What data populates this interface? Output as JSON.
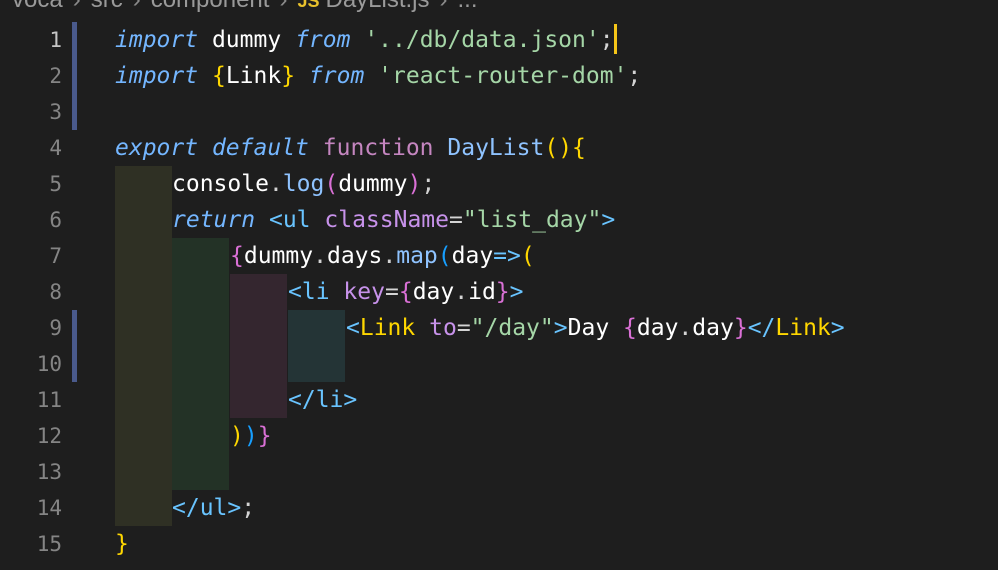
{
  "breadcrumb": [
    "voca",
    "src",
    "component",
    "DayList.js",
    "..."
  ],
  "breadcrumb_icon": "JS",
  "line_numbers": [
    "1",
    "2",
    "3",
    "4",
    "5",
    "6",
    "7",
    "8",
    "9",
    "10",
    "11",
    "12",
    "13",
    "14",
    "15"
  ],
  "code": {
    "l1": [
      "import",
      " ",
      "dummy",
      " ",
      "from",
      " ",
      "'../db/data.json'",
      ";"
    ],
    "l2": [
      "import",
      " ",
      "{",
      "Link",
      "}",
      " ",
      "from",
      " ",
      "'react-router-dom'",
      ";"
    ],
    "l4": [
      "export",
      " ",
      "default",
      " ",
      "function",
      " ",
      "DayList",
      "(",
      ")",
      "{"
    ],
    "l5": [
      "console",
      ".",
      "log",
      "(",
      "dummy",
      ")",
      ";"
    ],
    "l6": [
      "return",
      " ",
      "<",
      "ul",
      " ",
      "className",
      "=",
      "\"list_day\"",
      ">"
    ],
    "l7": [
      "{",
      "dummy",
      ".",
      "days",
      ".",
      "map",
      "(",
      "day",
      "=>",
      "("
    ],
    "l8": [
      "<",
      "li",
      " ",
      "key",
      "=",
      "{",
      "day",
      ".",
      "id",
      "}",
      ">"
    ],
    "l9": [
      "<",
      "Link",
      " ",
      "to",
      "=",
      "\"/day\"",
      ">",
      "Day ",
      "{",
      "day",
      ".",
      "day",
      "}",
      "</",
      "Link",
      ">"
    ],
    "l11": [
      "</",
      "li",
      ">"
    ],
    "l12": [
      ")",
      ")",
      "}"
    ],
    "l14": [
      "</",
      "ul",
      ">",
      ";"
    ],
    "l15": [
      "}"
    ]
  },
  "colors": {
    "background": "#1e1e1e",
    "guide_1": "#2f3024",
    "guide_2": "#233226",
    "guide_3": "#34262f",
    "guide_4": "#243436",
    "modified_bar": "#4a5a8c"
  }
}
